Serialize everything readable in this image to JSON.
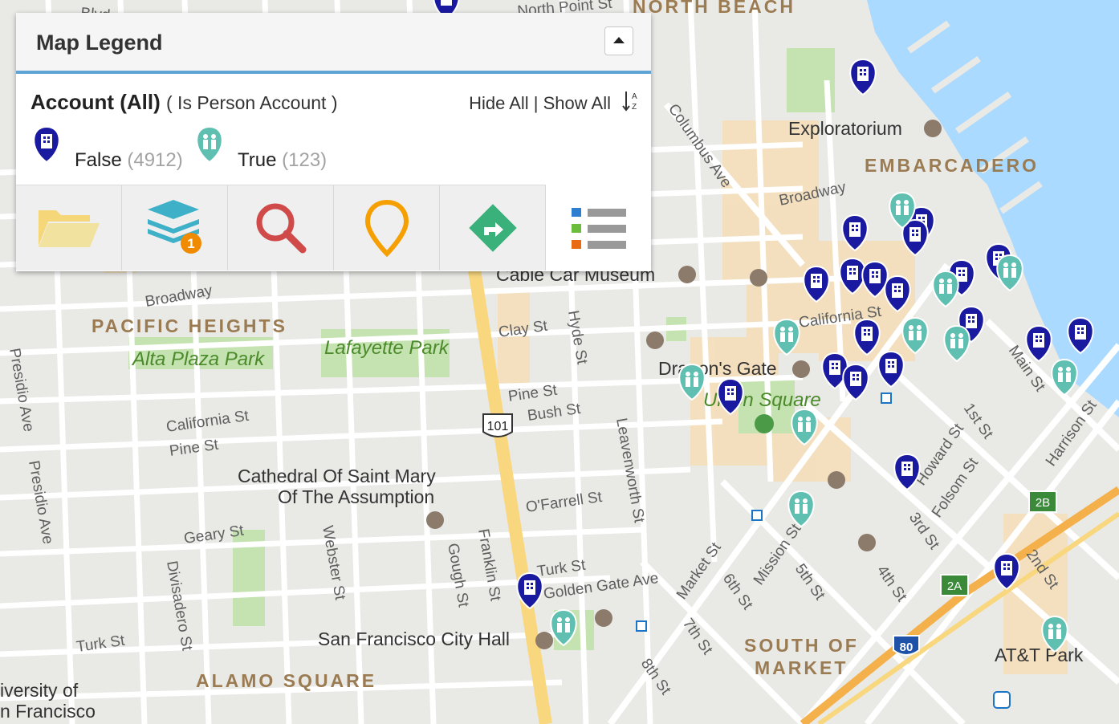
{
  "legend": {
    "title": "Map Legend",
    "group_name": "Account (All)",
    "group_filter": "( Is Person Account )",
    "hide_show": "Hide All | Show All",
    "items": [
      {
        "label": "False",
        "count": "(4912)",
        "color": "#1a1aa0"
      },
      {
        "label": "True",
        "count": "(123)",
        "color": "#5fbfb0"
      }
    ],
    "toolbar": [
      {
        "name": "folder-icon"
      },
      {
        "name": "layers-icon",
        "badge": "1"
      },
      {
        "name": "search-icon"
      },
      {
        "name": "pin-icon"
      },
      {
        "name": "directions-icon"
      },
      {
        "name": "list-icon"
      }
    ]
  },
  "map": {
    "districts": [
      "NORTH BEACH",
      "EMBARCADERO",
      "PACIFIC HEIGHTS",
      "ALAMO SQUARE",
      "SOUTH OF",
      "MARKET"
    ],
    "parks": [
      "Alta Plaza Park",
      "Lafayette Park",
      "Union Square"
    ],
    "pois": [
      "Exploratorium",
      "Cable Car Museum",
      "Dragon's Gate",
      "Cathedral Of Saint Mary",
      "Of The Assumption",
      "San Francisco City Hall",
      "AT&T Park",
      "iversity of",
      "n Francisco"
    ],
    "streets": [
      "Columbus Ave",
      "Broadway",
      "Broadway",
      "Clay St",
      "Hyde St",
      "Pine St",
      "Bush St",
      "California St",
      "Pine St",
      "Leavenworth St",
      "O'Farrell St",
      "Geary St",
      "Webster St",
      "Gough St",
      "Franklin St",
      "Turk St",
      "Golden Gate Ave",
      "Turk St",
      "Divisadero St",
      "Presidio Ave",
      "Presidio Ave",
      "Market St",
      "6th St",
      "7th St",
      "8th St",
      "Mission St",
      "5th St",
      "4th St",
      "3rd St",
      "Folsom St",
      "Howard St",
      "1st St",
      "2nd St",
      "Main St",
      "Harrison St",
      "California St",
      "North Point St",
      "Blvd"
    ],
    "shields": [
      "101",
      "80",
      "2B",
      "2A"
    ]
  }
}
